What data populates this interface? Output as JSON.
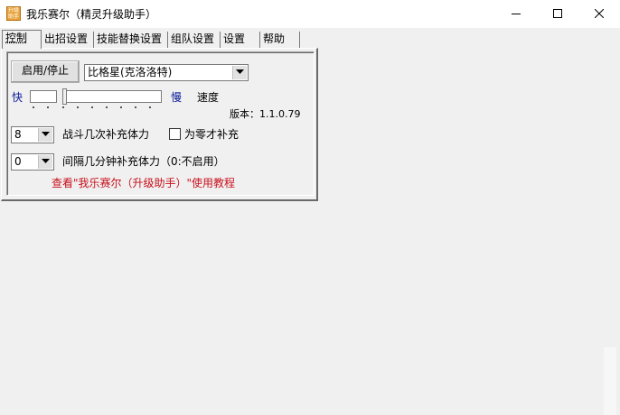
{
  "window": {
    "title": "我乐赛尔（精灵升级助手）",
    "icon_text": "升级助手"
  },
  "tabs": [
    {
      "label": "控制",
      "active": true
    },
    {
      "label": "出招设置",
      "active": false
    },
    {
      "label": "技能替换设置",
      "active": false
    },
    {
      "label": "组队设置",
      "active": false
    },
    {
      "label": "设置",
      "active": false
    },
    {
      "label": "帮助",
      "active": false
    }
  ],
  "control": {
    "toggle_button": "启用/停止",
    "pet_select": "比格星(克洛洛特)",
    "speed": {
      "fast_label": "快",
      "slow_label": "慢",
      "title": "速度",
      "level": 0
    },
    "version_label": "版本：",
    "version_value": "1.1.0.79",
    "battles_select": "8",
    "battles_label": "战斗几次补充体力",
    "zero_checkbox_label": "为零才补充",
    "zero_checkbox_checked": false,
    "interval_select": "0",
    "interval_label": "间隔几分钟补充体力（0:不启用）",
    "tutorial_link": "查看\"我乐赛尔（升级助手）\"使用教程"
  },
  "colors": {
    "accent_blue": "#0a1a96",
    "link_red": "#c8101c"
  }
}
